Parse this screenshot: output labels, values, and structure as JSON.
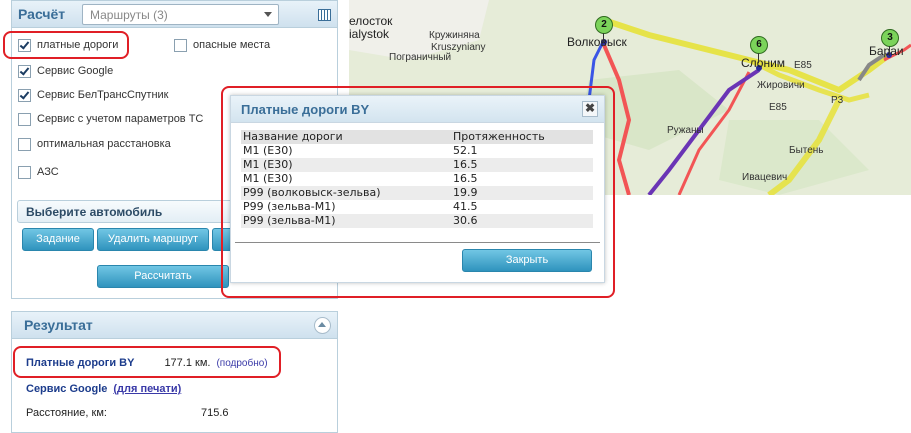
{
  "calc_panel": {
    "title": "Расчёт",
    "route_select_value": "Маршруты (3)",
    "checkboxes": [
      {
        "label": "платные дороги",
        "checked": true
      },
      {
        "label": "опасные места",
        "checked": false
      },
      {
        "label": "Сервис Google",
        "checked": true
      },
      {
        "label": "Сервис БелТрансСпутник",
        "checked": true
      },
      {
        "label": "Сервис с учетом параметров ТС",
        "checked": false
      },
      {
        "label": "оптимальная расстановка",
        "checked": false
      },
      {
        "label": "АЗС",
        "checked": false
      }
    ],
    "car_select_label": "Выберите автомобиль",
    "btn_task": "Задание",
    "btn_delete_route": "Удалить маршрут",
    "btn_calculate": "Рассчитать"
  },
  "result_panel": {
    "title": "Результат",
    "toll_label": "Платные дороги BY",
    "toll_value": "177.1 км.",
    "toll_link": "(подробно)",
    "google_label": "Сервис Google",
    "google_link": "(для печати)",
    "distance_label": "Расстояние, км:",
    "distance_value": "715.6"
  },
  "dialog": {
    "title": "Платные дороги BY",
    "close_glyph": "✖",
    "columns": [
      "Название дороги",
      "Протяженность"
    ],
    "rows": [
      [
        "M1 (E30)",
        "52.1"
      ],
      [
        "M1 (E30)",
        "16.5"
      ],
      [
        "M1 (E30)",
        "16.5"
      ],
      [
        "P99 (волковыск-зельва)",
        "19.9"
      ],
      [
        "P99 (зельва-M1)",
        "41.5"
      ],
      [
        "P99 (зельва-M1)",
        "30.6"
      ]
    ],
    "close_button": "Закрыть"
  },
  "map": {
    "labels": {
      "belostok": "елосток",
      "bialystok": "ialystok",
      "kruzhinyany": "Кружиняна",
      "kruszyniany": "Kruszyniany",
      "pogranichny": "Пограничный",
      "volkovysk": "Волковыск",
      "slonim": "Слоним",
      "zhirovichi": "Жировичи",
      "e85_a": "E85",
      "e85_b": "E85",
      "baranovichi": "Бараи",
      "ruzhany": "Ружаны",
      "bytyen": "Бытень",
      "ivatsevichi": "Ивацевич",
      "r3": "Р3"
    },
    "markers": [
      "2",
      "6",
      "3"
    ]
  },
  "colors": {
    "accent": "#3a6e98",
    "highlight": "#e01f26",
    "route_yellow": "#e6e23a",
    "route_red": "#f25555",
    "route_purple": "#6a35b5",
    "route_blue": "#3a55e6"
  }
}
